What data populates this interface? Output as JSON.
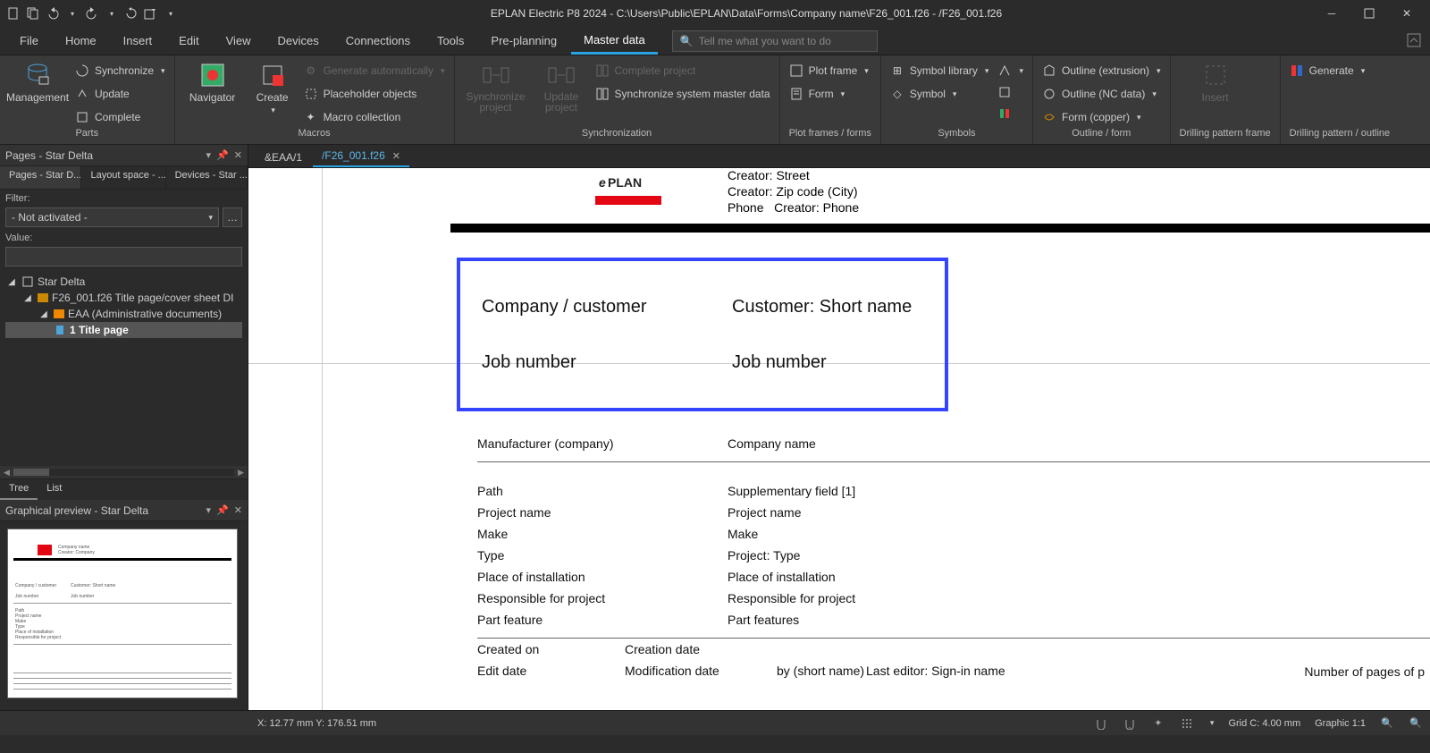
{
  "titlebar": {
    "title": "EPLAN Electric P8 2024 - C:\\Users\\Public\\EPLAN\\Data\\Forms\\Company name\\F26_001.f26 - /F26_001.f26"
  },
  "menu": {
    "file": "File",
    "home": "Home",
    "insert": "Insert",
    "edit": "Edit",
    "view": "View",
    "devices": "Devices",
    "connections": "Connections",
    "tools": "Tools",
    "preplanning": "Pre-planning",
    "masterdata": "Master data",
    "search_placeholder": "Tell me what you want to do"
  },
  "ribbon": {
    "parts": {
      "management": "Management",
      "synchronize": "Synchronize",
      "update": "Update",
      "complete": "Complete",
      "label": "Parts"
    },
    "macros": {
      "navigator": "Navigator",
      "create": "Create",
      "gen_auto": "Generate automatically",
      "placeholder": "Placeholder objects",
      "macro_coll": "Macro collection",
      "label": "Macros"
    },
    "sync": {
      "sync_project": "Synchronize project",
      "update_project": "Update project",
      "complete_project": "Complete project",
      "sync_master": "Synchronize system master data",
      "label": "Synchronization"
    },
    "plot": {
      "plot_frame": "Plot frame",
      "form": "Form",
      "label": "Plot frames / forms"
    },
    "symbols": {
      "library": "Symbol library",
      "symbol": "Symbol",
      "label": "Symbols"
    },
    "outline": {
      "extrusion": "Outline (extrusion)",
      "nc": "Outline (NC data)",
      "copper": "Form (copper)",
      "label": "Outline / form"
    },
    "drill_frame": {
      "insert": "Insert",
      "label": "Drilling pattern frame"
    },
    "drill_outline": {
      "generate": "Generate",
      "label": "Drilling pattern / outline"
    }
  },
  "pages_panel": {
    "title": "Pages - Star Delta",
    "subtabs": {
      "a": "Pages - Star D...",
      "b": "Layout space - ...",
      "c": "Devices - Star ..."
    },
    "filter_label": "Filter:",
    "filter_value": "- Not activated -",
    "value_label": "Value:",
    "tree": {
      "root": "Star Delta",
      "item1": "F26_001.f26 Title page/cover sheet DI",
      "item2": "EAA (Administrative documents)",
      "item3": "1 Title page"
    },
    "bottom_tree": "Tree",
    "bottom_list": "List"
  },
  "preview_panel": {
    "title": "Graphical preview - Star Delta"
  },
  "doctabs": {
    "tab1": "&EAA/1",
    "tab2": "/F26_001.f26"
  },
  "form": {
    "creator_street": "Creator: Street",
    "creator_zip": "Creator: Zip code (City)",
    "phone_lbl": "Phone",
    "creator_phone": "Creator: Phone",
    "company_customer": "Company / customer",
    "customer_short": "Customer: Short name",
    "job_number_l": "Job number",
    "job_number_r": "Job number",
    "manufacturer_l": "Manufacturer (company)",
    "manufacturer_r": "Company name",
    "path_l": "Path",
    "path_r": "Supplementary field [1]",
    "projname_l": "Project name",
    "projname_r": "Project name",
    "make_l": "Make",
    "make_r": "Make",
    "type_l": "Type",
    "type_r": "Project: Type",
    "place_l": "Place of installation",
    "place_r": "Place of installation",
    "resp_l": "Responsible for project",
    "resp_r": "Responsible for project",
    "part_l": "Part feature",
    "part_r": "Part features",
    "created_l": "Created on",
    "created_r": "Creation date",
    "edit_l": "Edit date",
    "edit_r": "Modification date",
    "by": "by (short name)",
    "lasted": "Last editor: Sign-in name",
    "numpages": "Number of pages of p"
  },
  "status": {
    "coords": "X: 12.77 mm Y: 176.51 mm",
    "grid": "Grid C: 4.00 mm",
    "graphic": "Graphic 1:1"
  }
}
